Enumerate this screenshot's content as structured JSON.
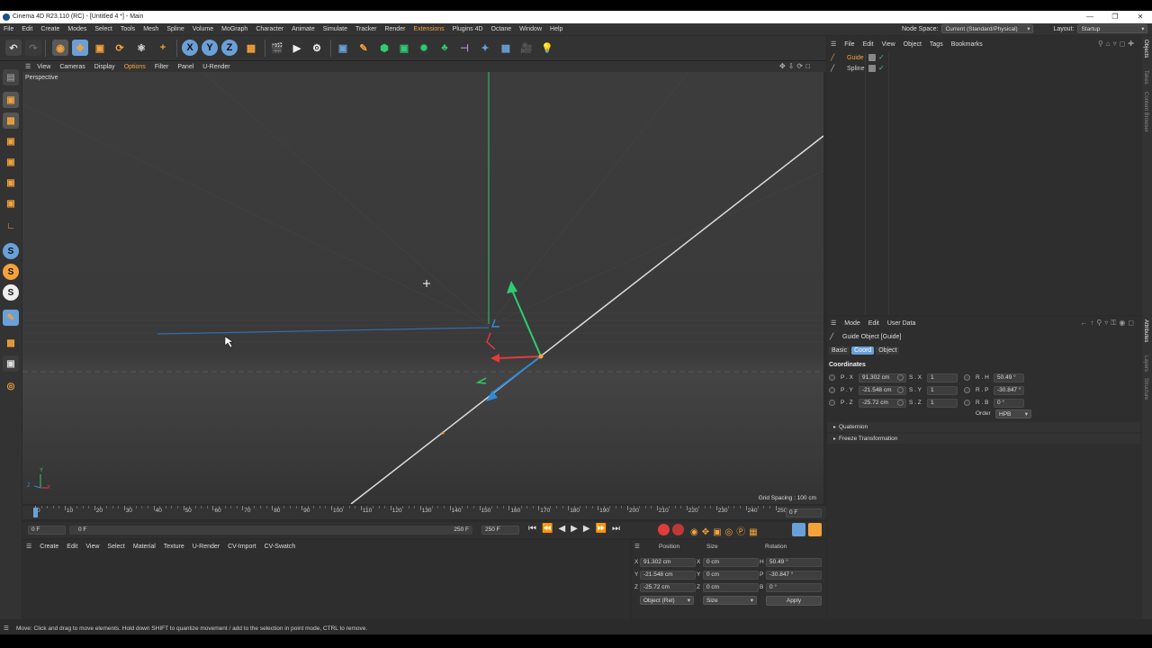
{
  "window": {
    "title": "Cinema 4D R23.110 (RC) - [Untitled 4 *] - Main"
  },
  "menu": [
    "File",
    "Edit",
    "Create",
    "Modes",
    "Select",
    "Tools",
    "Mesh",
    "Spline",
    "Volume",
    "MoGraph",
    "Character",
    "Animate",
    "Simulate",
    "Tracker",
    "Render",
    "Extensions",
    "Plugins 4D",
    "Octane",
    "Window",
    "Help"
  ],
  "menu_highlight": "Extensions",
  "nodespace": {
    "label": "Node Space:",
    "value": "Current (Standard/Physical)"
  },
  "layout": {
    "label": "Layout:",
    "value": "Startup"
  },
  "viewport": {
    "menu": [
      "View",
      "Cameras",
      "Display",
      "Options",
      "Filter",
      "Panel",
      "U-Render"
    ],
    "name": "Perspective",
    "grid_spacing": "Grid Spacing : 100 cm",
    "axis_labels": {
      "y": "Y",
      "z": "Z",
      "x": "X"
    }
  },
  "timeline": {
    "ticks": [
      "0",
      "10",
      "20",
      "30",
      "40",
      "50",
      "60",
      "70",
      "80",
      "90",
      "100",
      "110",
      "120",
      "130",
      "140",
      "150",
      "160",
      "170",
      "180",
      "190",
      "200",
      "210",
      "220",
      "230",
      "240",
      "250"
    ],
    "current_frame": "0 F",
    "start": "0 F",
    "start2": "0 F",
    "end": "250 F",
    "end2": "250 F"
  },
  "material_menu": [
    "Create",
    "Edit",
    "View",
    "Select",
    "Material",
    "Texture",
    "U-Render",
    "CV-Import",
    "CV-Swatch"
  ],
  "coords": {
    "headers": [
      "Position",
      "Size",
      "Rotation"
    ],
    "rows": [
      {
        "axis": "X",
        "pos": "91.302 cm",
        "size_axis": "X",
        "size": "0 cm",
        "rot_axis": "H",
        "rot": "50.49 °"
      },
      {
        "axis": "Y",
        "pos": "-21.548 cm",
        "size_axis": "Y",
        "size": "0 cm",
        "rot_axis": "P",
        "rot": "-30.847 °"
      },
      {
        "axis": "Z",
        "pos": "-25.72 cm",
        "size_axis": "Z",
        "size": "0 cm",
        "rot_axis": "B",
        "rot": "0 °"
      }
    ],
    "mode": "Object (Rel)",
    "size_mode": "Size",
    "apply": "Apply"
  },
  "objects": {
    "menu": [
      "File",
      "Edit",
      "View",
      "Object",
      "Tags",
      "Bookmarks"
    ],
    "items": [
      {
        "name": "Guide",
        "color": "#f3a23b"
      },
      {
        "name": "Spline",
        "color": "#cfcfcf"
      }
    ]
  },
  "attributes": {
    "menu": [
      "Mode",
      "Edit",
      "User Data"
    ],
    "object_title": "Guide Object [Guide]",
    "tabs": [
      "Basic",
      "Coord",
      "Object"
    ],
    "active_tab": "Coord",
    "section": "Coordinates",
    "rows": [
      {
        "p_label": "P . X",
        "p_val": "91.302 cm",
        "s_label": "S . X",
        "s_val": "1",
        "r_label": "R . H",
        "r_val": "50.49 °"
      },
      {
        "p_label": "P . Y",
        "p_val": "-21.548 cm",
        "s_label": "S . Y",
        "s_val": "1",
        "r_label": "R . P",
        "r_val": "-30.847 °"
      },
      {
        "p_label": "P . Z",
        "p_val": "-25.72 cm",
        "s_label": "S . Z",
        "s_val": "1",
        "r_label": "R . B",
        "r_val": "0 °"
      }
    ],
    "order_label": "Order",
    "order_value": "HPB",
    "groups": [
      "Quaternion",
      "Freeze Transformation"
    ]
  },
  "right_tabs": [
    "Objects",
    "Takes",
    "Content Browser",
    "Attributes",
    "Layers",
    "Structure"
  ],
  "status": "Move: Click and drag to move elements. Hold down SHIFT to quantize movement / add to the selection in point mode, CTRL to remove.",
  "colors": {
    "accent": "#f3a23b",
    "blue_btn": "#6aa0d8",
    "axis_x": "#e23b3b",
    "axis_y": "#2ecc71",
    "axis_z": "#2f8bd8"
  }
}
